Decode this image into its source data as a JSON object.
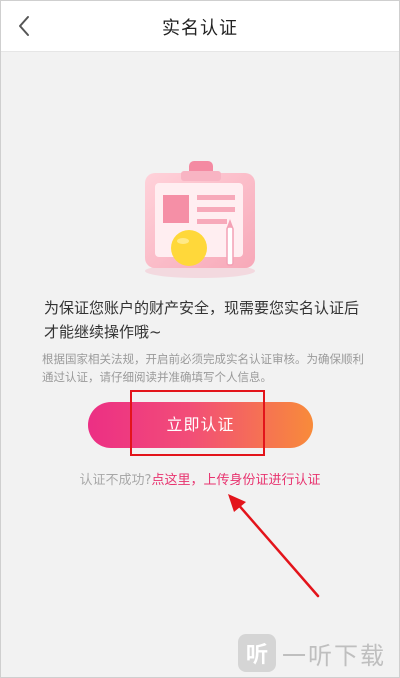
{
  "header": {
    "title": "实名认证"
  },
  "content": {
    "main_text": "为保证您账户的财产安全，现需要您实名认证后才能继续操作哦~",
    "sub_text": "根据国家相关法规，开启前必须完成实名认证审核。为确保顺利通过认证，请仔细阅读并准确填写个人信息。",
    "verify_button": "立即认证",
    "fail_prefix": "认证不成功?",
    "fail_link": "点这里，上传身份证进行认证"
  },
  "watermark": {
    "logo": "听",
    "text": "一听下载"
  },
  "colors": {
    "accent_pink": "#ec2f84",
    "accent_orange": "#f88b3a",
    "link": "#e8336f",
    "annotation_red": "#e3141b"
  }
}
